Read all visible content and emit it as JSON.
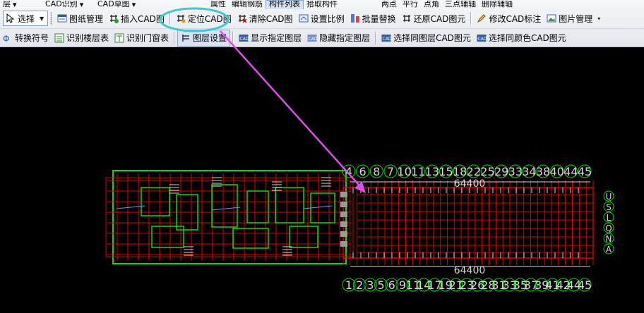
{
  "top_row": {
    "items": [
      "层",
      "CAD识别",
      "CAD草图",
      "属性",
      "编辑钢筋",
      "构件列表",
      "拾取构件",
      "两点",
      "平行",
      "点角",
      "三点辅轴",
      "删除辅轴"
    ]
  },
  "toolbar1": {
    "select_label": "选择",
    "items": [
      {
        "label": "图纸管理",
        "icon": "drawing-manage-icon"
      },
      {
        "label": "插入CAD图",
        "icon": "insert-cad-icon"
      },
      {
        "label": "定位CAD图",
        "icon": "locate-cad-icon"
      },
      {
        "label": "清除CAD图",
        "icon": "clear-cad-icon"
      },
      {
        "label": "设置比例",
        "icon": "scale-icon"
      },
      {
        "label": "批量替换",
        "icon": "batch-replace-icon"
      },
      {
        "label": "还原CAD图元",
        "icon": "restore-cad-icon"
      },
      {
        "label": "修改CAD标注",
        "icon": "edit-annotation-icon"
      },
      {
        "label": "图片管理",
        "icon": "image-manage-icon"
      }
    ]
  },
  "toolbar2": {
    "items": [
      {
        "label": "转换符号",
        "icon": "convert-symbol-icon"
      },
      {
        "label": "识别楼层表",
        "icon": "recognize-floor-icon"
      },
      {
        "label": "识别门窗表",
        "icon": "recognize-door-window-icon"
      },
      {
        "label": "图层设置",
        "icon": "layer-settings-icon"
      },
      {
        "label": "显示指定图层",
        "icon": "cad-show-layer-icon"
      },
      {
        "label": "隐藏指定图层",
        "icon": "cad-hide-layer-icon"
      },
      {
        "label": "选择同图层CAD图元",
        "icon": "cad-same-layer-icon"
      },
      {
        "label": "选择同颜色CAD图元",
        "icon": "cad-same-color-icon"
      }
    ]
  },
  "drawing": {
    "top_axis_numbers": [
      "4",
      "6",
      "8",
      "7",
      "10",
      "11",
      "13",
      "15",
      "18",
      "22",
      "25",
      "29",
      "33",
      "34",
      "38",
      "40",
      "44",
      "45"
    ],
    "bottom_axis_numbers": [
      "1",
      "2",
      "3",
      "5",
      "6",
      "9",
      "11",
      "14",
      "17",
      "19",
      "21",
      "23",
      "26",
      "28",
      "31",
      "33",
      "35",
      "37",
      "39",
      "41",
      "42",
      "44",
      "45"
    ],
    "top_dimension": "64400",
    "bottom_dimension": "64400",
    "right_axis_letters": [
      "U",
      "S",
      "L",
      "Q",
      "N",
      "A"
    ]
  },
  "colors": {
    "highlight_ellipse": "#3ec9d6",
    "annotation_arrow": "#e04cf0",
    "cad_green": "#00e000",
    "cad_red": "#e00000",
    "cad_white": "#d8d8d8"
  }
}
